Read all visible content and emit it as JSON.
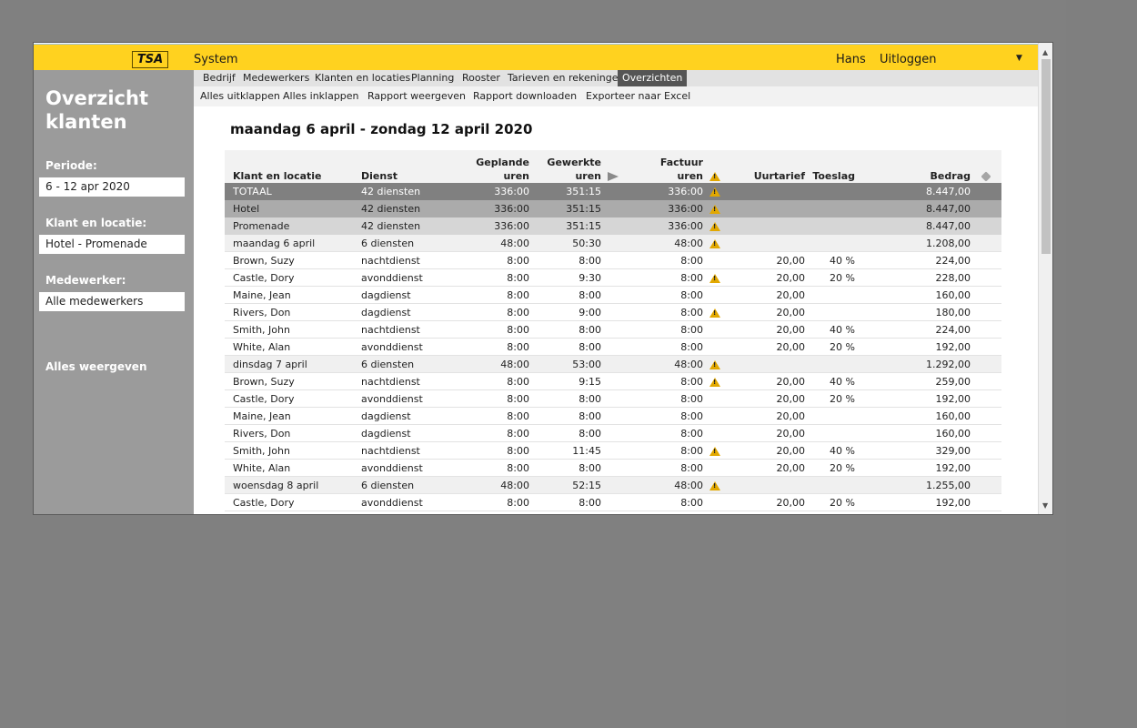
{
  "app": {
    "logo": "TSA",
    "system": "System",
    "user": "Hans",
    "logout": "Uitloggen"
  },
  "sidebar": {
    "title": "Overzicht klanten",
    "periode_label": "Periode:",
    "periode_value": "6 - 12 apr 2020",
    "klant_label": "Klant en locatie:",
    "klant_value": "Hotel - Promenade",
    "medewerker_label": "Medewerker:",
    "medewerker_value": "Alle medewerkers",
    "show_all": "Alles weergeven"
  },
  "nav": [
    "Bedrijf",
    "Medewerkers",
    "Klanten en locaties",
    "Planning",
    "Rooster",
    "Tarieven en rekeningen",
    "Overzichten"
  ],
  "nav_active": "Overzichten",
  "actions": [
    "Alles uitklappen",
    "Alles inklappen",
    "Rapport weergeven",
    "Rapport downloaden",
    "Exporteer naar Excel"
  ],
  "heading": "maandag 6 april - zondag 12 april 2020",
  "table": {
    "headers": {
      "klant": "Klant en locatie",
      "dienst": "Dienst",
      "geplande_1": "Geplande",
      "geplande_2": "uren",
      "gewerkte_1": "Gewerkte",
      "gewerkte_2": "uren",
      "factuur_1": "Factuur",
      "factuur_2": "uren",
      "uurtarief": "Uurtarief",
      "toeslag": "Toeslag",
      "bedrag": "Bedrag"
    },
    "rows": [
      {
        "kind": "total",
        "name": "TOTAAL",
        "dienst": "42 diensten",
        "geplande": "336:00",
        "gewerkte": "351:15",
        "factuur": "336:00",
        "warn": true,
        "uurtarief": "",
        "toeslag": "",
        "bedrag": "8.447,00"
      },
      {
        "kind": "client",
        "name": "Hotel",
        "dienst": "42 diensten",
        "geplande": "336:00",
        "gewerkte": "351:15",
        "factuur": "336:00",
        "warn": true,
        "uurtarief": "",
        "toeslag": "",
        "bedrag": "8.447,00"
      },
      {
        "kind": "location",
        "name": "Promenade",
        "dienst": "42 diensten",
        "geplande": "336:00",
        "gewerkte": "351:15",
        "factuur": "336:00",
        "warn": true,
        "uurtarief": "",
        "toeslag": "",
        "bedrag": "8.447,00"
      },
      {
        "kind": "day",
        "name": "maandag 6 april",
        "dienst": "6 diensten",
        "geplande": "48:00",
        "gewerkte": "50:30",
        "factuur": "48:00",
        "warn": true,
        "uurtarief": "",
        "toeslag": "",
        "bedrag": "1.208,00"
      },
      {
        "kind": "row",
        "name": "Brown, Suzy",
        "dienst": "nachtdienst",
        "geplande": "8:00",
        "gewerkte": "8:00",
        "factuur": "8:00",
        "warn": false,
        "uurtarief": "20,00",
        "toeslag": "40 %",
        "bedrag": "224,00"
      },
      {
        "kind": "row",
        "name": "Castle, Dory",
        "dienst": "avonddienst",
        "geplande": "8:00",
        "gewerkte": "9:30",
        "factuur": "8:00",
        "warn": true,
        "uurtarief": "20,00",
        "toeslag": "20 %",
        "bedrag": "228,00"
      },
      {
        "kind": "row",
        "name": "Maine, Jean",
        "dienst": "dagdienst",
        "geplande": "8:00",
        "gewerkte": "8:00",
        "factuur": "8:00",
        "warn": false,
        "uurtarief": "20,00",
        "toeslag": "",
        "bedrag": "160,00"
      },
      {
        "kind": "row",
        "name": "Rivers, Don",
        "dienst": "dagdienst",
        "geplande": "8:00",
        "gewerkte": "9:00",
        "factuur": "8:00",
        "warn": true,
        "uurtarief": "20,00",
        "toeslag": "",
        "bedrag": "180,00"
      },
      {
        "kind": "row",
        "name": "Smith, John",
        "dienst": "nachtdienst",
        "geplande": "8:00",
        "gewerkte": "8:00",
        "factuur": "8:00",
        "warn": false,
        "uurtarief": "20,00",
        "toeslag": "40 %",
        "bedrag": "224,00"
      },
      {
        "kind": "row",
        "name": "White, Alan",
        "dienst": "avonddienst",
        "geplande": "8:00",
        "gewerkte": "8:00",
        "factuur": "8:00",
        "warn": false,
        "uurtarief": "20,00",
        "toeslag": "20 %",
        "bedrag": "192,00"
      },
      {
        "kind": "day",
        "name": "dinsdag 7 april",
        "dienst": "6 diensten",
        "geplande": "48:00",
        "gewerkte": "53:00",
        "factuur": "48:00",
        "warn": true,
        "uurtarief": "",
        "toeslag": "",
        "bedrag": "1.292,00"
      },
      {
        "kind": "row",
        "name": "Brown, Suzy",
        "dienst": "nachtdienst",
        "geplande": "8:00",
        "gewerkte": "9:15",
        "factuur": "8:00",
        "warn": true,
        "uurtarief": "20,00",
        "toeslag": "40 %",
        "bedrag": "259,00"
      },
      {
        "kind": "row",
        "name": "Castle, Dory",
        "dienst": "avonddienst",
        "geplande": "8:00",
        "gewerkte": "8:00",
        "factuur": "8:00",
        "warn": false,
        "uurtarief": "20,00",
        "toeslag": "20 %",
        "bedrag": "192,00"
      },
      {
        "kind": "row",
        "name": "Maine, Jean",
        "dienst": "dagdienst",
        "geplande": "8:00",
        "gewerkte": "8:00",
        "factuur": "8:00",
        "warn": false,
        "uurtarief": "20,00",
        "toeslag": "",
        "bedrag": "160,00"
      },
      {
        "kind": "row",
        "name": "Rivers, Don",
        "dienst": "dagdienst",
        "geplande": "8:00",
        "gewerkte": "8:00",
        "factuur": "8:00",
        "warn": false,
        "uurtarief": "20,00",
        "toeslag": "",
        "bedrag": "160,00"
      },
      {
        "kind": "row",
        "name": "Smith, John",
        "dienst": "nachtdienst",
        "geplande": "8:00",
        "gewerkte": "11:45",
        "factuur": "8:00",
        "warn": true,
        "uurtarief": "20,00",
        "toeslag": "40 %",
        "bedrag": "329,00"
      },
      {
        "kind": "row",
        "name": "White, Alan",
        "dienst": "avonddienst",
        "geplande": "8:00",
        "gewerkte": "8:00",
        "factuur": "8:00",
        "warn": false,
        "uurtarief": "20,00",
        "toeslag": "20 %",
        "bedrag": "192,00"
      },
      {
        "kind": "day",
        "name": "woensdag 8 april",
        "dienst": "6 diensten",
        "geplande": "48:00",
        "gewerkte": "52:15",
        "factuur": "48:00",
        "warn": true,
        "uurtarief": "",
        "toeslag": "",
        "bedrag": "1.255,00"
      },
      {
        "kind": "row",
        "name": "Castle, Dory",
        "dienst": "avonddienst",
        "geplande": "8:00",
        "gewerkte": "8:00",
        "factuur": "8:00",
        "warn": false,
        "uurtarief": "20,00",
        "toeslag": "20 %",
        "bedrag": "192,00"
      }
    ]
  },
  "colors": {
    "accent": "#ffd21f",
    "sidebar": "#9b9b9b",
    "active_tab": "#555555",
    "warning": "#e2a800"
  }
}
